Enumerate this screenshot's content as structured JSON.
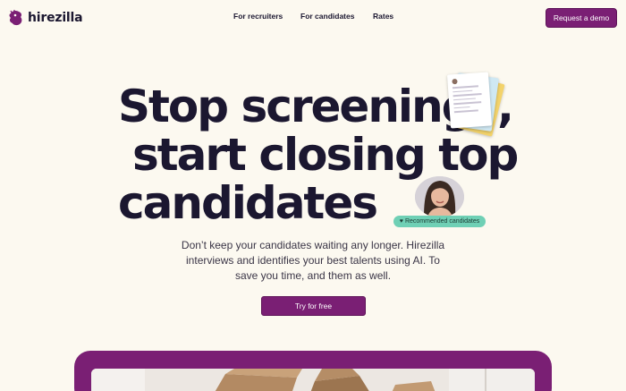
{
  "brand": {
    "name": "hirezilla",
    "logo_icon": "hirezilla-mascot-icon",
    "color": "#7a1f74"
  },
  "nav": {
    "links": [
      "For recruiters",
      "For candidates",
      "Rates"
    ],
    "cta": "Request a demo"
  },
  "hero": {
    "headline_lines": [
      "Stop screening",
      ",",
      "start closing top",
      "candidates"
    ],
    "subtitle": "Don’t keep your candidates waiting any longer. Hirezilla interviews and identifies your best talents using AI. To save you time, and them as well.",
    "cta": "Try for free",
    "badge": "Recommended candidates",
    "badge_icon": "heart-icon"
  },
  "colors": {
    "background": "#fcf9f0",
    "accent": "#7a1f74",
    "badge": "#6fd0b5",
    "text": "#1b1730"
  }
}
